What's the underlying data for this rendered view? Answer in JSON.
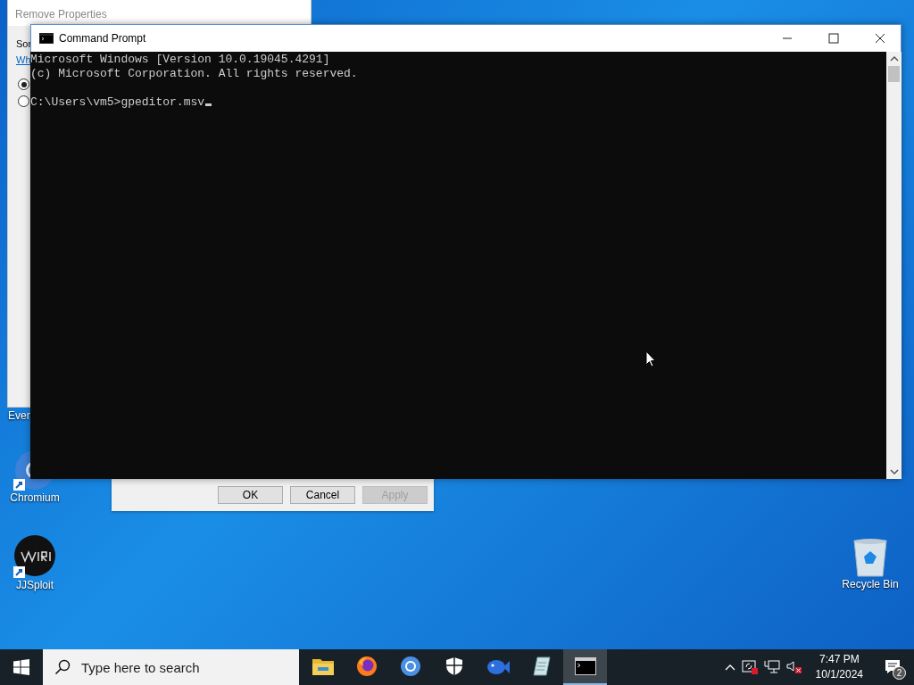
{
  "desktop_icons": [
    {
      "kind": "partial",
      "label": "Ever"
    },
    {
      "kind": "chromium",
      "label": "Chromium"
    },
    {
      "kind": "jjsploit",
      "label": "JJSploit"
    },
    {
      "kind": "recycle",
      "label": "Recycle Bin"
    }
  ],
  "background_dialog": {
    "title": "Remove Properties",
    "text": "Sor",
    "link": "Wh",
    "radios": [
      {
        "selected": true
      },
      {
        "selected": false
      }
    ]
  },
  "dialog_buttons": [
    {
      "label": "OK",
      "disabled": false
    },
    {
      "label": "Cancel",
      "disabled": false
    },
    {
      "label": "Apply",
      "disabled": true
    }
  ],
  "console": {
    "title": "Command Prompt",
    "lines": [
      "Microsoft Windows [Version 10.0.19045.4291]",
      "(c) Microsoft Corporation. All rights reserved."
    ],
    "prompt": "C:\\Users\\vm5>",
    "input": "gpeditor.msv"
  },
  "taskbar": {
    "search": {
      "placeholder": "Type here to search"
    },
    "apps": [
      {
        "kind": "folder",
        "selected": false
      },
      {
        "kind": "firefox",
        "selected": false
      },
      {
        "kind": "chromium",
        "selected": false
      },
      {
        "kind": "shield",
        "selected": false
      },
      {
        "kind": "fish",
        "selected": false
      },
      {
        "kind": "notepad",
        "selected": false
      },
      {
        "kind": "console",
        "selected": true
      }
    ],
    "time": "7:47 PM",
    "date": "10/1/2024",
    "notifications": "2"
  }
}
